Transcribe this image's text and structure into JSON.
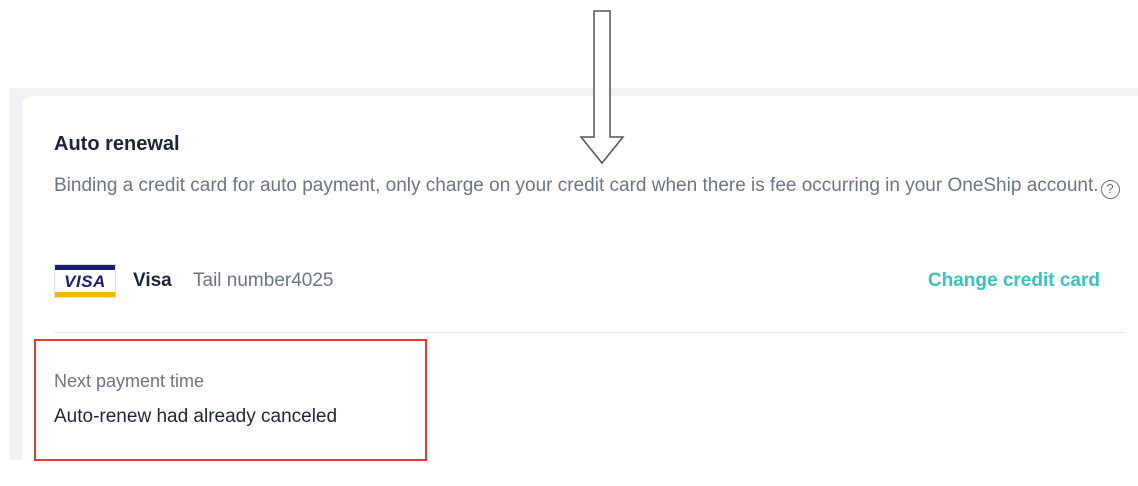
{
  "auto_renewal": {
    "title": "Auto renewal",
    "description": "Binding a credit card for auto payment, only charge on your credit card when there is fee occurring in your OneShip account.",
    "help_icon": "question-circle-icon"
  },
  "credit_card": {
    "logo_text": "VISA",
    "brand": "Visa",
    "tail_number": "Tail number4025",
    "change_label": "Change credit card"
  },
  "next_payment": {
    "label": "Next payment time",
    "value": "Auto-renew had already canceled"
  },
  "annotations": {
    "arrow": "down-arrow-icon",
    "highlight_color": "#e23a2e"
  },
  "colors": {
    "accent": "#3cc0c0",
    "visa_blue": "#1a1f71",
    "visa_gold": "#f7b600"
  }
}
